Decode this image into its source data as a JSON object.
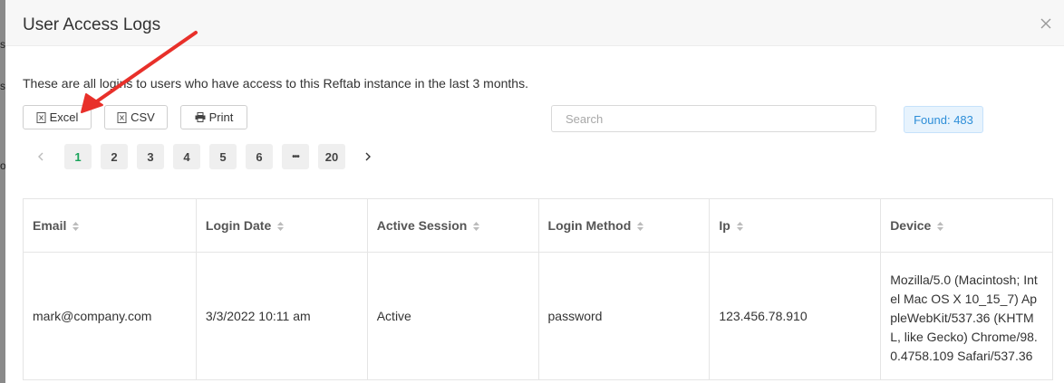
{
  "modal": {
    "title": "User Access Logs",
    "description": "These are all logins to users who have access to this Reftab instance in the last 3 months."
  },
  "toolbar": {
    "excel_label": "Excel",
    "csv_label": "CSV",
    "print_label": "Print"
  },
  "search": {
    "placeholder": "Search"
  },
  "found_badge": "Found: 483",
  "pagination": {
    "pages": [
      "1",
      "2",
      "3",
      "4",
      "5",
      "6",
      "•••",
      "20"
    ],
    "current": "1"
  },
  "table": {
    "headers": [
      "Email",
      "Login Date",
      "Active Session",
      "Login Method",
      "Ip",
      "Device"
    ],
    "rows": [
      [
        "mark@company.com",
        "3/3/2022 10:11 am",
        "Active",
        "password",
        "123.456.78.910",
        "Mozilla/5.0 (Macintosh; Intel Mac OS X 10_15_7) AppleWebKit/537.36 (KHTML, like Gecko) Chrome/98.0.4758.109 Safari/537.36"
      ]
    ]
  },
  "colors": {
    "accent_active_page": "#1aa35a",
    "badge_text": "#2d8ed8",
    "annotation_arrow": "#e8302a"
  }
}
